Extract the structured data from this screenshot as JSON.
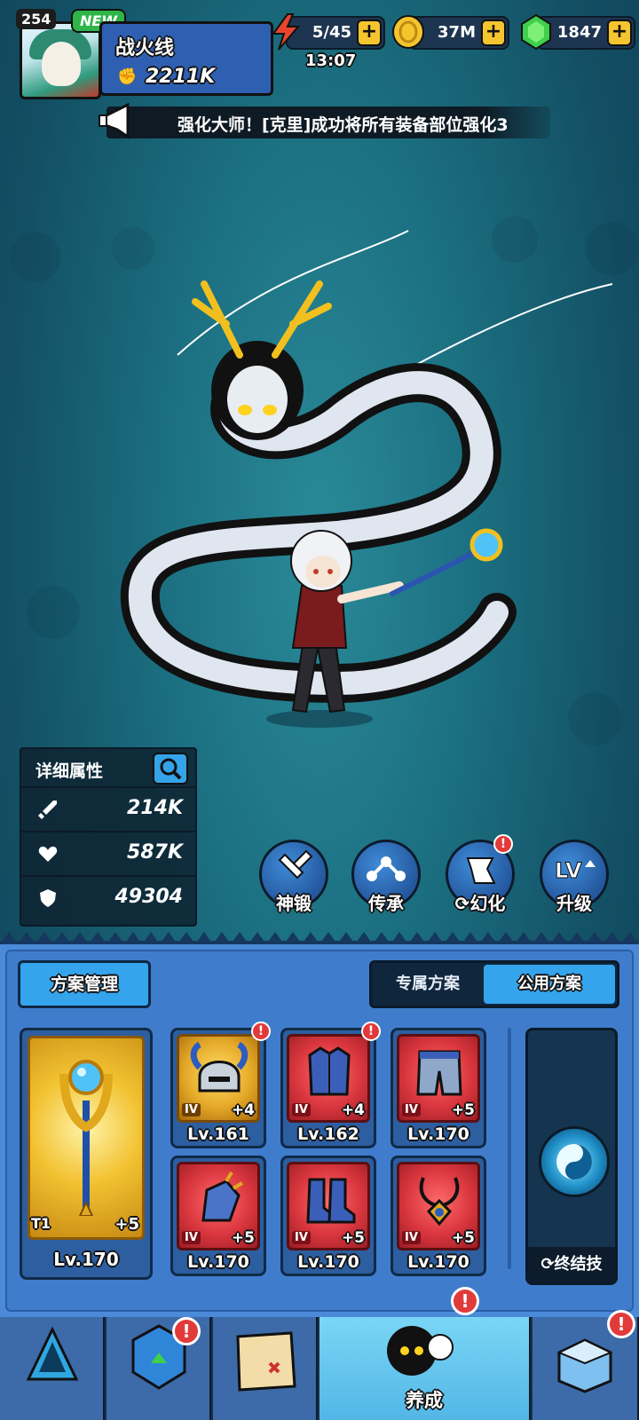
{
  "profile": {
    "level": "254",
    "new_badge": "NEW",
    "name": "战火线",
    "power": "2211K"
  },
  "resources": {
    "energy": "5/45",
    "energy_timer": "13:07",
    "gold": "37M",
    "gems": "1847",
    "plus": "+"
  },
  "ticker": {
    "message": "强化大师！[克里]成功将所有装备部位强化3"
  },
  "stats": {
    "title": "详细属性",
    "attack": "214K",
    "hp": "587K",
    "defense": "49304"
  },
  "actions": [
    {
      "label": "神锻",
      "icon": "hammer-icon"
    },
    {
      "label": "传承",
      "icon": "link-icon"
    },
    {
      "label": "幻化",
      "icon": "transform-icon",
      "alert": "!"
    },
    {
      "label": "升级",
      "icon": "level-up-icon"
    }
  ],
  "equipment": {
    "scheme_manage": "方案管理",
    "scheme_tabs": {
      "exclusive": "专属方案",
      "public": "公用方案",
      "selected": "公用方案"
    },
    "weapon": {
      "tier": "T1",
      "enhance": "+5",
      "level": "Lv.170"
    },
    "slots": [
      {
        "rank": "IV",
        "enhance": "+4",
        "level": "Lv.161",
        "alert": "!",
        "icon": "helmet-icon"
      },
      {
        "rank": "IV",
        "enhance": "+4",
        "level": "Lv.162",
        "alert": "!",
        "icon": "armor-icon"
      },
      {
        "rank": "IV",
        "enhance": "+5",
        "level": "Lv.170",
        "icon": "pants-icon"
      },
      {
        "rank": "IV",
        "enhance": "+5",
        "level": "Lv.170",
        "icon": "gauntlet-icon"
      },
      {
        "rank": "IV",
        "enhance": "+5",
        "level": "Lv.170",
        "icon": "boots-icon"
      },
      {
        "rank": "IV",
        "enhance": "+5",
        "level": "Lv.170",
        "icon": "necklace-icon"
      }
    ],
    "ultimate_label": "终结技"
  },
  "tabs": [
    {
      "label": "",
      "icon": "crystal-tab-icon"
    },
    {
      "label": "",
      "icon": "upgrade-tab-icon",
      "alert": "!"
    },
    {
      "label": "",
      "icon": "map-tab-icon"
    },
    {
      "label": "养成",
      "icon": "character-tab-icon",
      "alert": "!",
      "active": true
    },
    {
      "label": "",
      "icon": "shop-tab-icon",
      "alert": "!"
    }
  ],
  "colors": {
    "accent_blue": "#34a4ec",
    "alert_red": "#e23a3a",
    "gold": "#f5c530",
    "panel_blue": "#4a8ad8"
  }
}
